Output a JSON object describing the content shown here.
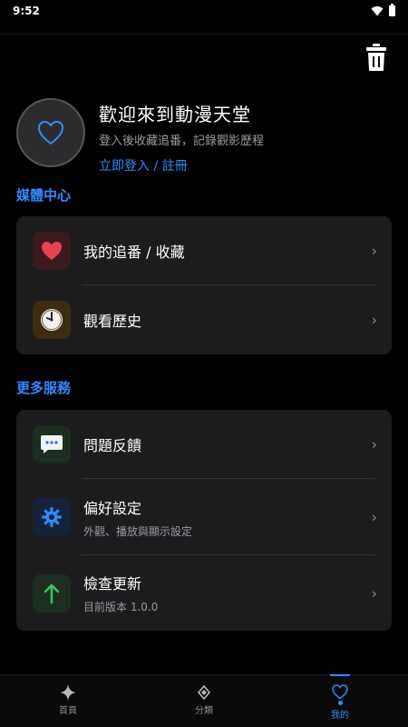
{
  "status_bar": {
    "time": "9:52"
  },
  "profile": {
    "title": "歡迎來到動漫天堂",
    "subtitle": "登入後收藏追番，記錄觀影歷程",
    "login_link": "立即登入 / 註冊"
  },
  "media_section": {
    "title": "媒體中心",
    "items": [
      {
        "label": "我的追番 / 收藏",
        "icon": "heart-icon",
        "icon_bg": "#3a1a1c"
      },
      {
        "label": "觀看歷史",
        "icon": "clock-icon",
        "icon_bg": "#3d2c12"
      }
    ]
  },
  "more_section": {
    "title": "更多服務",
    "items": [
      {
        "label": "問題反饋",
        "icon": "chat-bubble-icon",
        "icon_bg": "#1b2e1f"
      },
      {
        "label": "偏好設定",
        "sub": "外觀、播放與顯示設定",
        "icon": "gear-icon",
        "icon_bg": "#14233a"
      },
      {
        "label": "檢查更新",
        "sub": "目前版本 1.0.0",
        "icon": "arrow-up-icon",
        "icon_bg": "#1b2e1f"
      }
    ]
  },
  "bottom_nav": {
    "items": [
      {
        "label": "首頁",
        "icon": "sparkle-icon"
      },
      {
        "label": "分類",
        "icon": "diamond-icon"
      },
      {
        "label": "我的",
        "icon": "heart-outline-icon"
      }
    ],
    "active": "我的"
  },
  "colors": {
    "accent": "#2f8cff",
    "card_bg": "#1c1c1e",
    "background": "#000000"
  }
}
